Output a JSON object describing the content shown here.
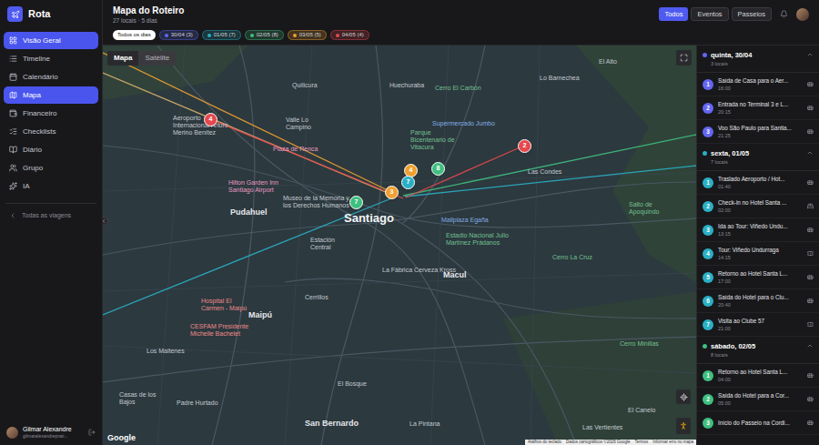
{
  "app": {
    "name": "Rota"
  },
  "sidebar": {
    "items": [
      {
        "label": "Visão Geral",
        "selected": true
      },
      {
        "label": "Timeline",
        "selected": false
      },
      {
        "label": "Calendário",
        "selected": false
      },
      {
        "label": "Mapa",
        "selected": true
      },
      {
        "label": "Financeiro",
        "selected": false
      },
      {
        "label": "Checklists",
        "selected": false
      },
      {
        "label": "Diário",
        "selected": false
      },
      {
        "label": "Grupo",
        "selected": false
      },
      {
        "label": "IA",
        "selected": false
      }
    ],
    "back": "Todas as viagens",
    "user": {
      "name": "Gilmar Alexandre",
      "email": "gilmaralexandreprati..."
    }
  },
  "header": {
    "title": "Mapa do Roteiro",
    "subtitle": "27 locais · 5 dias",
    "filters": [
      {
        "label": "Todos",
        "selected": true
      },
      {
        "label": "Eventos",
        "selected": false
      },
      {
        "label": "Passeios",
        "selected": false
      }
    ]
  },
  "day_filter": {
    "all": {
      "label": "Todos os dias",
      "selected": true
    },
    "days": [
      {
        "label": "30/04 (3)",
        "color": "#5b6cf0",
        "selected": false
      },
      {
        "label": "01/05 (7)",
        "color": "#2ab0c5",
        "selected": false
      },
      {
        "label": "02/05 (8)",
        "color": "#3fbf7f",
        "selected": false
      },
      {
        "label": "03/05 (5)",
        "color": "#f0a030",
        "selected": false
      },
      {
        "label": "04/05 (4)",
        "color": "#e5484d",
        "selected": false
      }
    ]
  },
  "map": {
    "types": [
      {
        "label": "Mapa",
        "selected": true
      },
      {
        "label": "Satélite",
        "selected": false
      }
    ],
    "labels": [
      {
        "text": "Quilicura",
        "kind": "place"
      },
      {
        "text": "Valle Lo Campino",
        "kind": "place"
      },
      {
        "text": "Huechuraba",
        "kind": "place"
      },
      {
        "text": "Lo Barnechea",
        "kind": "place"
      },
      {
        "text": "El Alto",
        "kind": "place"
      },
      {
        "text": "Cerro El Carbón",
        "kind": "park"
      },
      {
        "text": "Parque Bicentenario de Vitacura",
        "kind": "park"
      },
      {
        "text": "Supermercado Jumbo",
        "kind": "shop"
      },
      {
        "text": "Las Condes",
        "kind": "place"
      },
      {
        "text": "Plaza de Renca",
        "kind": "hotel"
      },
      {
        "text": "Aeroporto Internacional Arturo Merino Benítez",
        "kind": "place"
      },
      {
        "text": "Hilton Garden Inn Santiago Airport",
        "kind": "hotel"
      },
      {
        "text": "Pudahuel",
        "kind": "city"
      },
      {
        "text": "Museo de la Memoria y los Derechos Humanos",
        "kind": "place"
      },
      {
        "text": "Santiago",
        "kind": "capital"
      },
      {
        "text": "Mallplaza Egaña",
        "kind": "shop"
      },
      {
        "text": "Estación Central",
        "kind": "place"
      },
      {
        "text": "Estadio Nacional Julio Martínez Prádanos",
        "kind": "park"
      },
      {
        "text": "La Fábrica Cerveza Kross",
        "kind": "place"
      },
      {
        "text": "Macul",
        "kind": "city"
      },
      {
        "text": "Cerrillos",
        "kind": "place"
      },
      {
        "text": "Hospital El Carmen - Maipú",
        "kind": "hospital"
      },
      {
        "text": "Maipú",
        "kind": "city"
      },
      {
        "text": "CESFAM Presidente Michelle Bachelet",
        "kind": "hospital"
      },
      {
        "text": "Los Maitenes",
        "kind": "place"
      },
      {
        "text": "Padre Hurtado",
        "kind": "place"
      },
      {
        "text": "El Bosque",
        "kind": "place"
      },
      {
        "text": "San Bernardo",
        "kind": "city"
      },
      {
        "text": "La Pintana",
        "kind": "place"
      },
      {
        "text": "Las Vertientes",
        "kind": "place"
      },
      {
        "text": "El Canelo",
        "kind": "place"
      },
      {
        "text": "Cerro Minillas",
        "kind": "park"
      },
      {
        "text": "Salto de Apoquindo",
        "kind": "park"
      },
      {
        "text": "Cerro La Cruz",
        "kind": "park"
      },
      {
        "text": "Casas de los Bajos",
        "kind": "place"
      }
    ],
    "markers": [
      {
        "label": "4",
        "color": "#e5484d"
      },
      {
        "label": "2",
        "color": "#e5484d"
      },
      {
        "label": "4",
        "color": "#f0a030"
      },
      {
        "label": "3",
        "color": "#f0a030"
      },
      {
        "label": "7",
        "color": "#2ab0c5"
      },
      {
        "label": "8",
        "color": "#3fbf7f"
      },
      {
        "label": "7",
        "color": "#3fbf7f"
      }
    ],
    "routes": [
      {
        "color": "#f0a030"
      },
      {
        "color": "#d9b36a"
      },
      {
        "color": "#e5484d"
      },
      {
        "color": "#2ab0c5"
      },
      {
        "color": "#3fbf7f"
      },
      {
        "color": "#2ab0c5"
      },
      {
        "color": "#e5484d"
      }
    ],
    "attribution": {
      "logo": "Google",
      "links": [
        "Atalhos do teclado",
        "Dados cartográficos ©2026 Google",
        "Termos",
        "Informar erro no mapa"
      ]
    }
  },
  "panel": {
    "groups": [
      {
        "title": "quinta, 30/04",
        "count": "3 locais",
        "color": "#6366f1",
        "expanded": true,
        "items": [
          {
            "number": "1",
            "title": "Saída de Casa para o Aer...",
            "time": "16:00",
            "kind": "transport"
          },
          {
            "number": "2",
            "title": "Entrada no Terminal 3 e L...",
            "time": "20:15",
            "kind": "transport"
          },
          {
            "number": "3",
            "title": "Voo São Paulo para Santia...",
            "time": "21:25",
            "kind": "transport"
          }
        ]
      },
      {
        "title": "sexta, 01/05",
        "count": "7 locais",
        "color": "#2ab0c5",
        "expanded": true,
        "items": [
          {
            "number": "1",
            "title": "Traslado Aeroporto / Hot...",
            "time": "01:40",
            "kind": "transport"
          },
          {
            "number": "2",
            "title": "Check-in no Hotel Santa ...",
            "time": "02:00",
            "kind": "hotel"
          },
          {
            "number": "3",
            "title": "Ida ao Tour: Viñedo Undu...",
            "time": "13:15",
            "kind": "transport"
          },
          {
            "number": "4",
            "title": "Tour: Viñedo Undurraga",
            "time": "14:15",
            "kind": "activity"
          },
          {
            "number": "5",
            "title": "Retorno ao Hotel Santa L...",
            "time": "17:00",
            "kind": "transport"
          },
          {
            "number": "6",
            "title": "Saída do Hotel para o Clu...",
            "time": "20:40",
            "kind": "transport"
          },
          {
            "number": "7",
            "title": "Visita ao Clube 57",
            "time": "21:00",
            "kind": "activity"
          }
        ]
      },
      {
        "title": "sábado, 02/05",
        "count": "8 locais",
        "color": "#3fbf7f",
        "expanded": true,
        "items": [
          {
            "number": "1",
            "title": "Retorno ao Hotel Santa L...",
            "time": "04:00",
            "kind": "transport"
          },
          {
            "number": "2",
            "title": "Saída do Hotel para a Cor...",
            "time": "05:00",
            "kind": "transport"
          },
          {
            "number": "3",
            "title": "Início do Passeio na Cordi...",
            "kind": "transport"
          }
        ]
      }
    ]
  }
}
